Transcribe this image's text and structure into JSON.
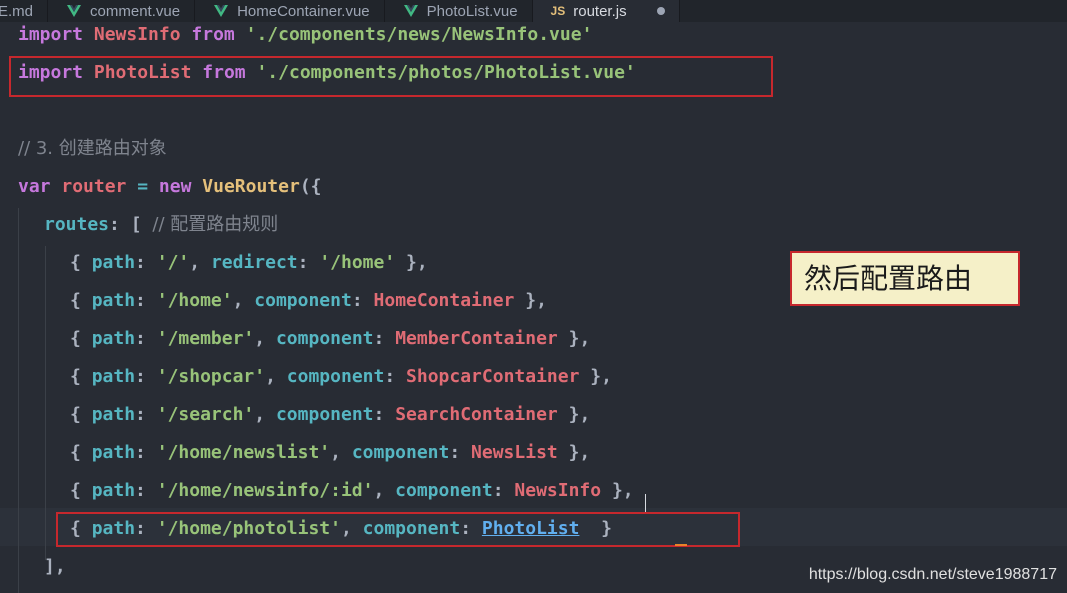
{
  "tabs": [
    {
      "label": "E.md",
      "icon": "none"
    },
    {
      "label": "comment.vue",
      "icon": "vue-icon"
    },
    {
      "label": "HomeContainer.vue",
      "icon": "vue-icon"
    },
    {
      "label": "PhotoList.vue",
      "icon": "vue-icon"
    },
    {
      "label": "router.js",
      "icon": "js-icon",
      "icon_text": "JS",
      "active": true,
      "dirty": true
    }
  ],
  "code": {
    "l1": {
      "kw1": "import",
      "id": "NewsInfo",
      "kw2": "from",
      "str": "'./components/news/NewsInfo.vue'"
    },
    "l2": {
      "kw1": "import",
      "id": "PhotoList",
      "kw2": "from",
      "str": "'./components/photos/PhotoList.vue'"
    },
    "l3": {
      "comment": "// 3. 创建路由对象"
    },
    "l4": {
      "kw1": "var",
      "id": "router",
      "eq": "=",
      "kw2": "new",
      "cls": "VueRouter",
      "punc": "({"
    },
    "l5": {
      "prop": "routes",
      "punc": ": [",
      "comment": "// 配置路由规则"
    },
    "routes": [
      {
        "path": "'/'",
        "key2": "redirect",
        "val": "'/home'",
        "val_is_str": true
      },
      {
        "path": "'/home'",
        "key2": "component",
        "val": "HomeContainer"
      },
      {
        "path": "'/member'",
        "key2": "component",
        "val": "MemberContainer"
      },
      {
        "path": "'/shopcar'",
        "key2": "component",
        "val": "ShopcarContainer"
      },
      {
        "path": "'/search'",
        "key2": "component",
        "val": "SearchContainer"
      },
      {
        "path": "'/home/newslist'",
        "key2": "component",
        "val": "NewsList"
      },
      {
        "path": "'/home/newsinfo/:id'",
        "key2": "component",
        "val": "NewsInfo"
      },
      {
        "path": "'/home/photolist'",
        "key2": "component",
        "val": "PhotoList",
        "last": true
      }
    ],
    "close": "],",
    "path_key": "path"
  },
  "annotation": "然后配置路由",
  "watermark": "https://blog.csdn.net/steve1988717",
  "colors": {
    "background": "#282c34",
    "keyword": "#c678dd",
    "identifier": "#e06c75",
    "string": "#98c379",
    "property": "#56b6c2",
    "highlight_box": "#c6282d",
    "annotation_bg": "#f5f0c8"
  }
}
